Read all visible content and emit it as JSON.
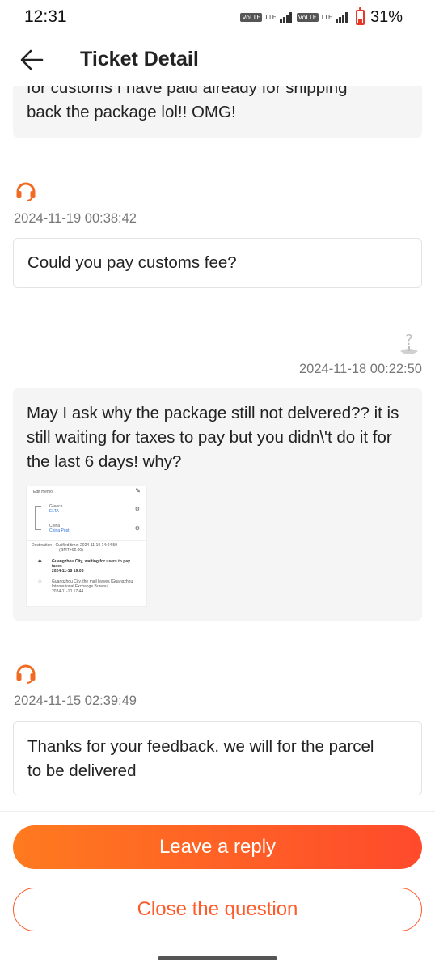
{
  "status_bar": {
    "time": "12:31",
    "volte_label": "VoLTE",
    "lte_label": "LTE",
    "battery_percent": "31%"
  },
  "header": {
    "title": "Ticket Detail",
    "back_icon": "arrow-left-icon"
  },
  "messages": [
    {
      "sender": "user",
      "text_partial_top": "for customs I have paid already for shipping",
      "text": "back the package lol!! OMG!"
    },
    {
      "sender": "agent",
      "timestamp": "2024-11-19 00:38:42",
      "text": "Could you pay customs fee?"
    },
    {
      "sender": "user",
      "timestamp": "2024-11-18 00:22:50",
      "text": "May I ask why the package still not delvered?? it is still waiting for taxes to pay but you didn\\'t do it for the last 6 days! why?",
      "attachment": {
        "edit_label": "Edit memo",
        "origin_country": "Greece",
        "origin_carrier": "ELTA",
        "dest_country": "China",
        "dest_carrier": "China Post",
        "destination_line": "Destination · Cutified time: 2024-11-10 14:04:59",
        "tz": "(GMT+02:00)",
        "event1_title": "Guangzhou City, waiting for users to pay taxes",
        "event1_time": "2024-11-18 19:06",
        "event2_title": "Guangzhou City, the mail leaves [Guangzhou International Exchange Bureau]",
        "event2_time": "2024-11-10 17:44"
      }
    },
    {
      "sender": "agent",
      "timestamp": "2024-11-15 02:39:49",
      "text": "Thanks for your feedback. we will for the parcel to be delivered"
    }
  ],
  "actions": {
    "reply_label": "Leave a reply",
    "close_label": "Close the question"
  },
  "colors": {
    "accent": "#ff5a2a",
    "gradient_start": "#ff7a1f",
    "gradient_end": "#ff4a2c",
    "agent_icon": "#f26a22"
  }
}
